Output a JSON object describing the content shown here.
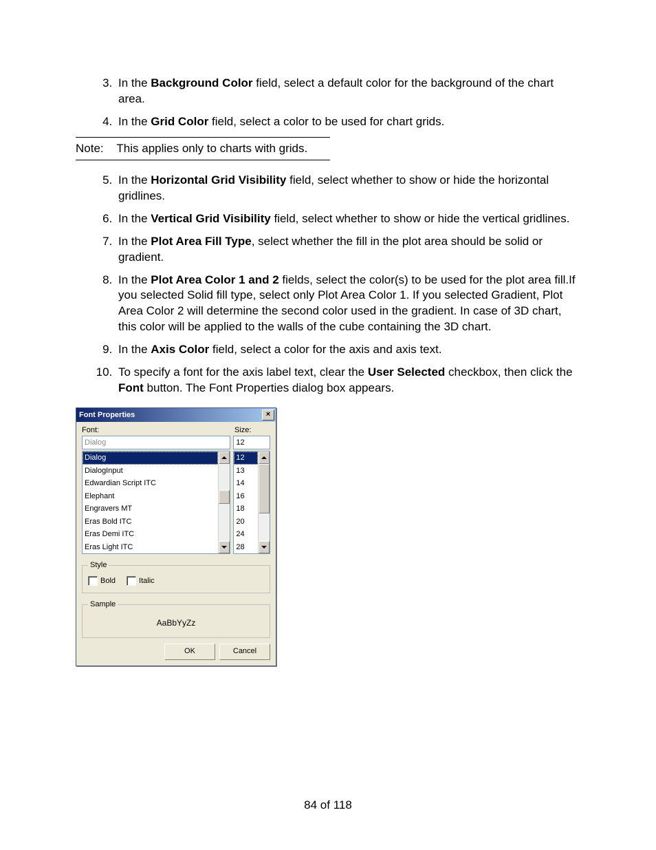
{
  "list1": {
    "items": [
      {
        "num": "3.",
        "pre": "In the ",
        "bold": "Background Color",
        "post": " field, select a default color for the background of the chart area."
      },
      {
        "num": "4.",
        "pre": "In the ",
        "bold": "Grid Color",
        "post": " field, select a color to be used for chart grids."
      }
    ]
  },
  "note": {
    "label": "Note:",
    "text": "This applies only to charts with grids."
  },
  "list2": {
    "items": [
      {
        "num": "5.",
        "pre": "In the ",
        "bold": "Horizontal Grid Visibility",
        "post": " field, select whether to show or hide the horizontal gridlines."
      },
      {
        "num": "6.",
        "pre": "In the ",
        "bold": "Vertical Grid Visibility",
        "post": " field, select whether to show or hide the vertical gridlines."
      },
      {
        "num": "7.",
        "pre": "In the ",
        "bold": "Plot Area Fill Type",
        "post": ", select whether the fill in the plot area should be solid or gradient."
      },
      {
        "num": "8.",
        "pre": "In the ",
        "bold": "Plot Area Color 1 and 2",
        "post": " fields, select the color(s) to be used for the plot area fill.If you selected Solid fill type, select only Plot Area Color 1. If you selected Gradient, Plot Area Color 2 will determine the second color used in the gradient. In case of 3D chart, this color will be applied to the walls of the cube containing the 3D chart."
      },
      {
        "num": "9.",
        "pre": "In the ",
        "bold": "Axis Color",
        "post": " field, select a color for the axis and axis text."
      }
    ]
  },
  "item10": {
    "num": "10.",
    "seg1": "To specify a font for the axis label text, clear the ",
    "bold1": "User Selected",
    "seg2": " checkbox, then click the ",
    "bold2": "Font",
    "seg3": " button. The Font Properties dialog box appears."
  },
  "dialog": {
    "title": "Font Properties",
    "font_label": "Font:",
    "size_label": "Size:",
    "font_value": "Dialog",
    "size_value": "12",
    "fonts": [
      "Dialog",
      "DialogInput",
      "Edwardian Script ITC",
      "Elephant",
      "Engravers MT",
      "Eras Bold ITC",
      "Eras Demi ITC",
      "Eras Light ITC"
    ],
    "sizes": [
      "12",
      "13",
      "14",
      "16",
      "18",
      "20",
      "24",
      "28"
    ],
    "style_legend": "Style",
    "bold_label": "Bold",
    "italic_label": "Italic",
    "sample_legend": "Sample",
    "sample_text": "AaBbYyZz",
    "ok": "OK",
    "cancel": "Cancel"
  },
  "page_number": "84 of 118"
}
